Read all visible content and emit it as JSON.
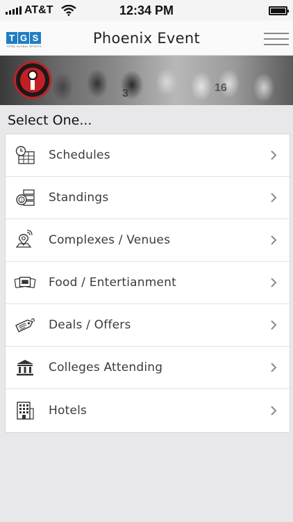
{
  "status_bar": {
    "carrier": "AT&T",
    "time": "12:34 PM"
  },
  "header": {
    "logo_letters": [
      "T",
      "G",
      "S"
    ],
    "logo_subtitle": "TOTAL GLOBAL SPORTS",
    "title": "Phoenix Event"
  },
  "section_heading": "Select One...",
  "menu_items": [
    {
      "label": "Schedules",
      "icon": "calendar-clock-icon"
    },
    {
      "label": "Standings",
      "icon": "standings-icon"
    },
    {
      "label": "Complexes / Venues",
      "icon": "location-pin-icon"
    },
    {
      "label": "Food / Entertianment",
      "icon": "tickets-icon"
    },
    {
      "label": "Deals / Offers",
      "icon": "price-tag-icon"
    },
    {
      "label": "Colleges Attending",
      "icon": "college-building-icon"
    },
    {
      "label": "Hotels",
      "icon": "hotel-building-icon"
    }
  ],
  "colors": {
    "brand_blue": "#1f7ec3",
    "badge_red": "#c41e25",
    "background": "#e8e8ea"
  }
}
